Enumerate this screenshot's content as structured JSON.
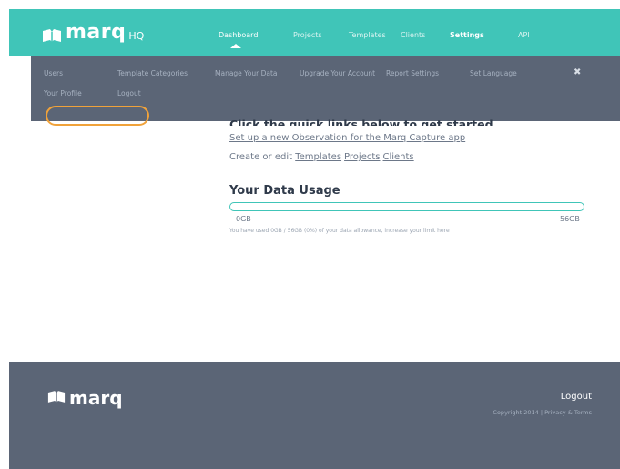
{
  "brand": {
    "name": "marq",
    "suffix": "HQ",
    "accent": "#40c5b8"
  },
  "nav": {
    "items": [
      {
        "label": "Dashboard"
      },
      {
        "label": "Projects"
      },
      {
        "label": "Templates"
      },
      {
        "label": "Clients"
      },
      {
        "label": "Settings"
      },
      {
        "label": "API"
      }
    ],
    "active": "Settings"
  },
  "settings_menu": {
    "row1": [
      "Users",
      "Template Categories",
      "Manage Your Data",
      "Upgrade Your Account",
      "Report Settings",
      "Set Language"
    ],
    "row2": [
      "Your Profile",
      "Logout"
    ],
    "close_icon": "close-icon"
  },
  "main": {
    "heading": "Click the quick links below to get started",
    "observation_link": "Set up a new Observation for the Marq Capture app",
    "create_prefix": "Create or edit",
    "create_links": [
      "Templates",
      "Projects",
      "Clients"
    ],
    "usage_title": "Your Data Usage",
    "usage_min": "0GB",
    "usage_max": "56GB",
    "usage_fraction": 0,
    "usage_note": "You have used 0GB / 56GB (0%) of your data allowance, increase your limit here"
  },
  "footer": {
    "brand": "marq",
    "logout": "Logout",
    "copyright": "Copyright 2014 | Privacy & Terms"
  }
}
